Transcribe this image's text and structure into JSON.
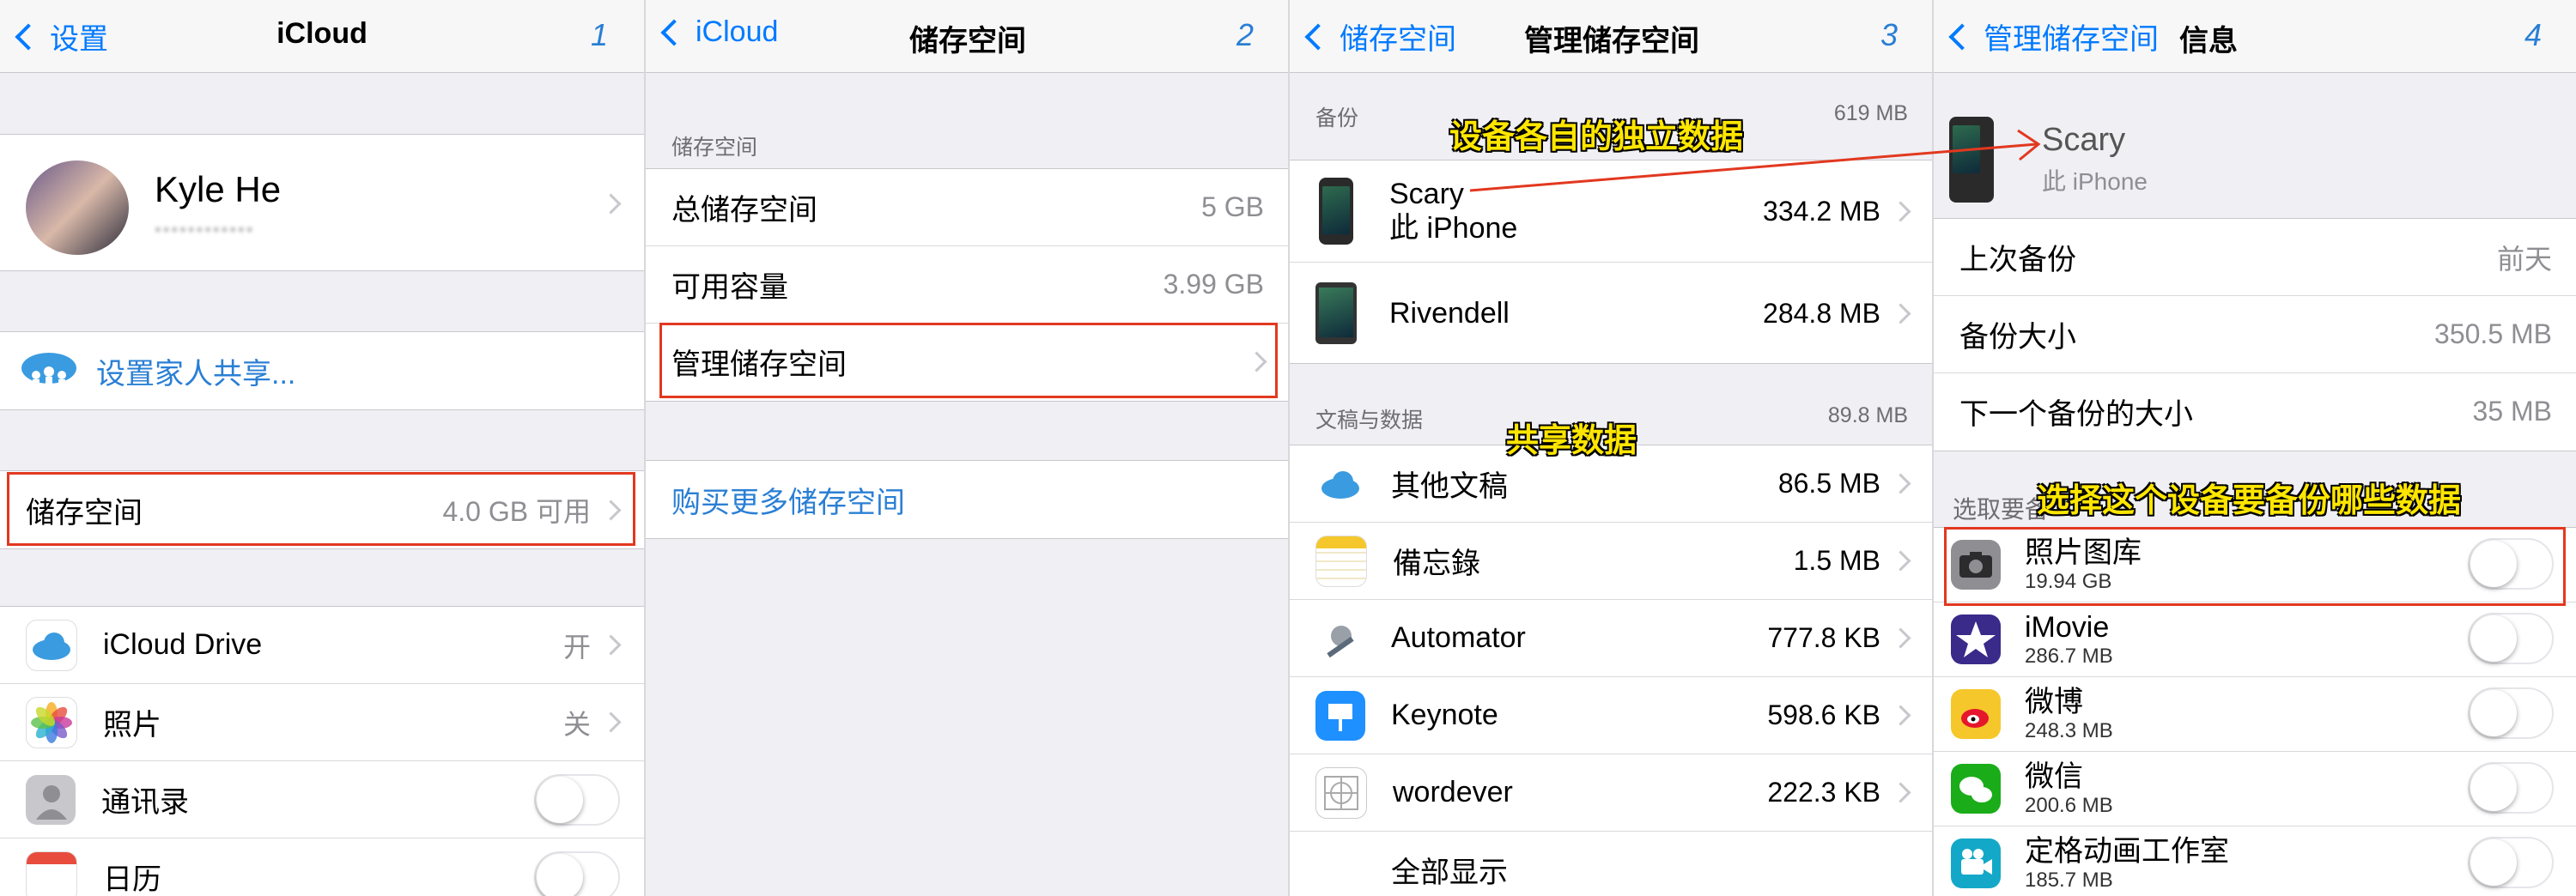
{
  "panel1": {
    "nav": {
      "back": "设置",
      "title": "iCloud",
      "num": "1"
    },
    "profile": {
      "name": "Kyle He",
      "email_masked": "••••••••••••"
    },
    "family": "设置家人共享...",
    "storage": {
      "label": "储存空间",
      "value": "4.0 GB 可用"
    },
    "items": [
      {
        "label": "iCloud Drive",
        "value": "开",
        "icon": "icloud-drive-icon"
      },
      {
        "label": "照片",
        "value": "关",
        "icon": "photos-icon"
      },
      {
        "label": "通讯录",
        "icon": "contacts-icon"
      },
      {
        "label": "日历",
        "icon": "calendar-icon"
      }
    ]
  },
  "panel2": {
    "nav": {
      "back": "iCloud",
      "title": "储存空间",
      "num": "2"
    },
    "section": "储存空间",
    "rows": [
      {
        "label": "总储存空间",
        "value": "5 GB"
      },
      {
        "label": "可用容量",
        "value": "3.99 GB"
      },
      {
        "label": "管理储存空间"
      }
    ],
    "buy": "购买更多储存空间"
  },
  "panel3": {
    "nav": {
      "back": "储存空间",
      "title": "管理储存空间",
      "num": "3"
    },
    "backup_header": "备份",
    "backup_total": "619 MB",
    "annot_backup": "设备各自的独立数据",
    "devices": [
      {
        "name": "Scary",
        "sub": "此 iPhone",
        "size": "334.2 MB"
      },
      {
        "name": "Rivendell",
        "size": "284.8 MB"
      }
    ],
    "docs_header": "文稿与数据",
    "docs_total": "89.8 MB",
    "annot_docs": "共享数据",
    "apps": [
      {
        "name": "其他文稿",
        "size": "86.5 MB",
        "icon": "icloud-icon"
      },
      {
        "name": "備忘錄",
        "size": "1.5 MB",
        "icon": "notes-icon"
      },
      {
        "name": "Automator",
        "size": "777.8 KB",
        "icon": "automator-icon"
      },
      {
        "name": "Keynote",
        "size": "598.6 KB",
        "icon": "keynote-icon"
      },
      {
        "name": "wordever",
        "size": "222.3 KB",
        "icon": "wordever-icon"
      }
    ],
    "show_all": "全部显示"
  },
  "panel4": {
    "nav": {
      "back": "管理储存空间",
      "title": "信息",
      "num": "4"
    },
    "device": {
      "name": "Scary",
      "sub": "此 iPhone"
    },
    "rows": [
      {
        "label": "上次备份",
        "value": "前天"
      },
      {
        "label": "备份大小",
        "value": "350.5 MB"
      },
      {
        "label": "下一个备份的大小",
        "value": "35 MB"
      }
    ],
    "section_prefix": "选取要备",
    "annot": "选择这个设备要备份哪些数据",
    "apps": [
      {
        "name": "照片图库",
        "size": "19.94 GB",
        "icon": "camera-icon"
      },
      {
        "name": "iMovie",
        "size": "286.7 MB",
        "icon": "imovie-icon"
      },
      {
        "name": "微博",
        "size": "248.3 MB",
        "icon": "weibo-icon"
      },
      {
        "name": "微信",
        "size": "200.6 MB",
        "icon": "wechat-icon"
      },
      {
        "name": "定格动画工作室",
        "size": "185.7 MB",
        "icon": "stop-motion-icon"
      }
    ]
  }
}
